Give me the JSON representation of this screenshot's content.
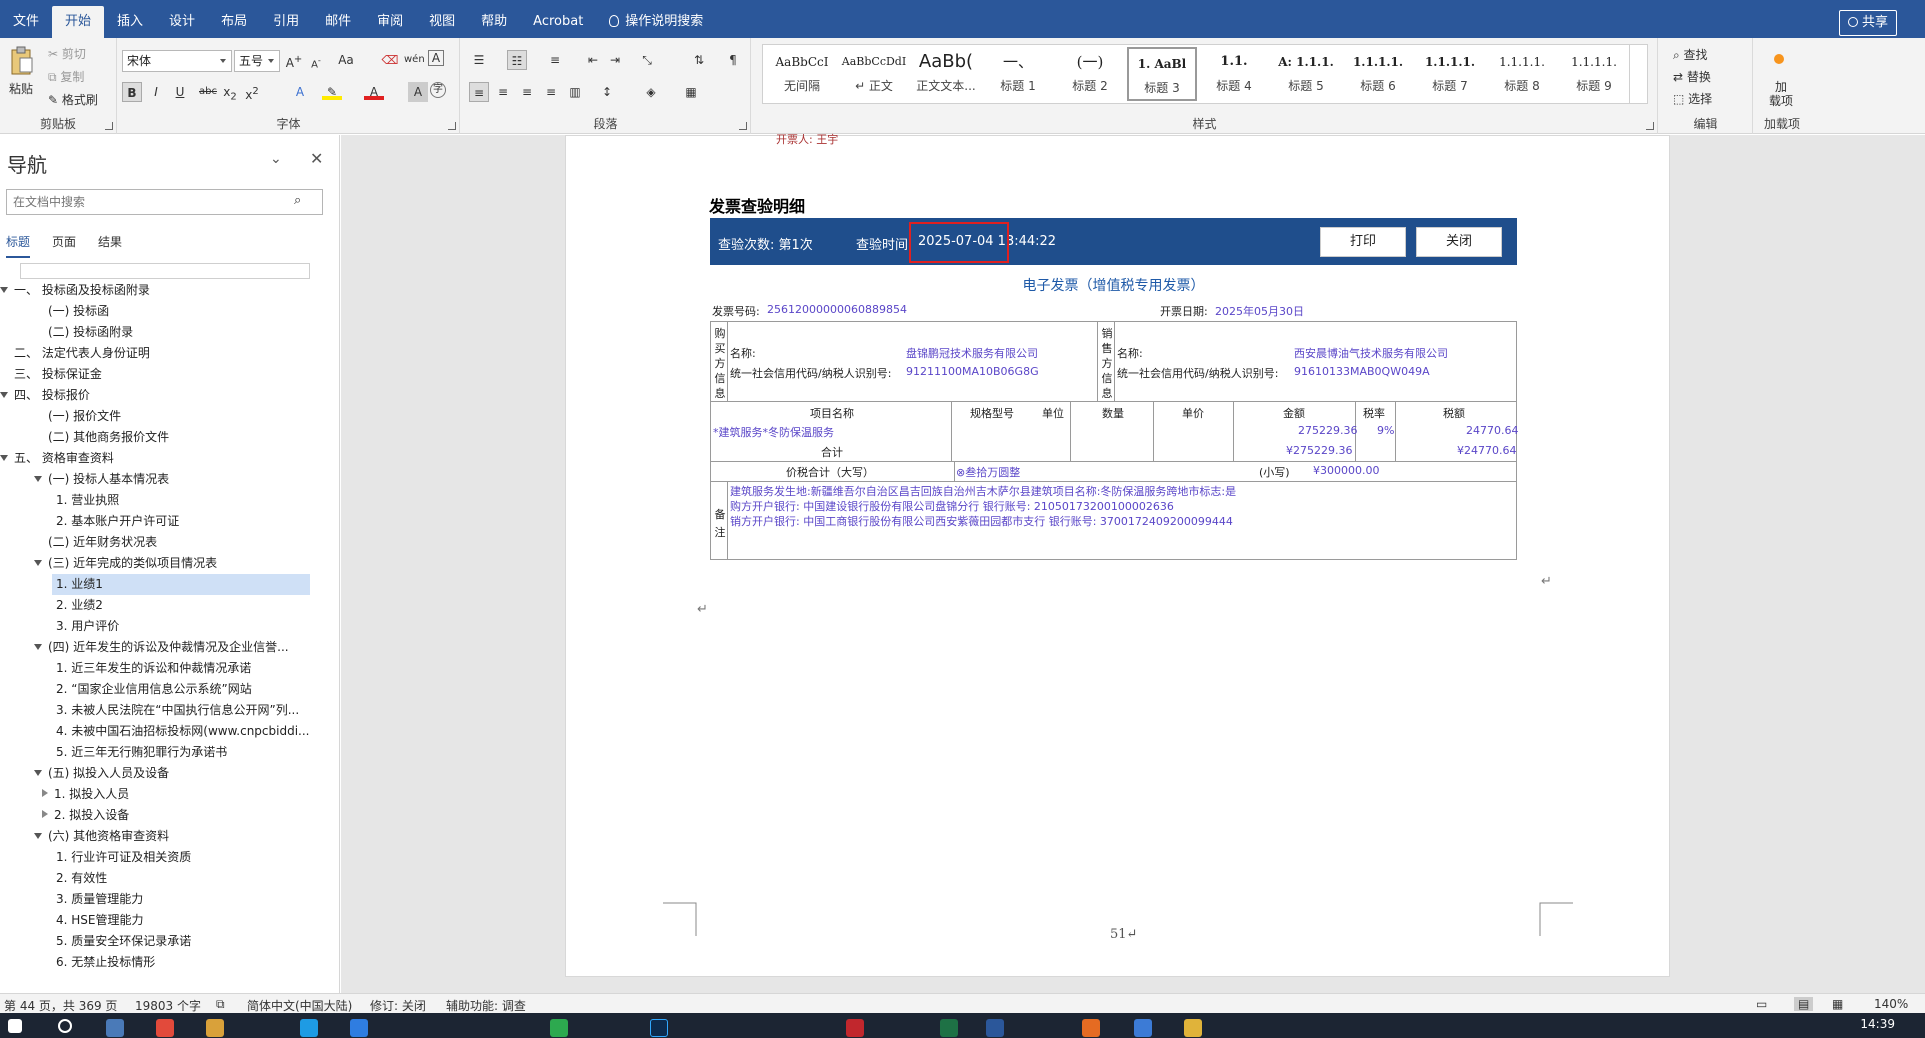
{
  "menu": {
    "items": [
      "文件",
      "开始",
      "插入",
      "设计",
      "布局",
      "引用",
      "邮件",
      "审阅",
      "视图",
      "帮助",
      "Acrobat"
    ],
    "tell_me": "操作说明搜索",
    "share": "共享"
  },
  "ribbon": {
    "clipboard": {
      "paste": "粘贴",
      "cut": "剪切",
      "copy": "复制",
      "format_painter": "格式刷",
      "label": "剪贴板"
    },
    "font": {
      "name": "宋体",
      "size": "五号",
      "label": "字体",
      "case": "Aa"
    },
    "paragraph": {
      "label": "段落"
    },
    "styles": {
      "label": "样式",
      "items": [
        {
          "preview": "AaBbCcI",
          "name": "无间隔"
        },
        {
          "preview": "AaBbCcDdI",
          "name": "↵ 正文"
        },
        {
          "preview": "AaBb(",
          "name": "正文文本..."
        },
        {
          "preview": "一、",
          "name": "标题 1"
        },
        {
          "preview": "(一)",
          "name": "标题 2"
        },
        {
          "preview": "1. AaBl",
          "name": "标题 3"
        },
        {
          "preview": "1.1.",
          "name": "标题 4"
        },
        {
          "preview": "A: 1.1.1.",
          "name": "标题 5"
        },
        {
          "preview": "1.1.1.1.",
          "name": "标题 6"
        },
        {
          "preview": "1.1.1.1.",
          "name": "标题 7"
        },
        {
          "preview": "1.1.1.1.",
          "name": "标题 8"
        },
        {
          "preview": "1.1.1.1.",
          "name": "标题 9"
        }
      ]
    },
    "editing": {
      "find": "查找",
      "replace": "替换",
      "select": "选择",
      "label": "编辑"
    },
    "addins": {
      "btn": "加\n载项",
      "label": "加载项"
    }
  },
  "nav": {
    "title": "导航",
    "search_placeholder": "在文档中搜索",
    "tabs": [
      "标题",
      "页面",
      "结果"
    ],
    "items": [
      {
        "text": "一、 投标函及投标函附录",
        "level": 0,
        "toggle": "open"
      },
      {
        "text": "(一)  投标函",
        "level": 1,
        "toggle": ""
      },
      {
        "text": "(二)  投标函附录",
        "level": 1,
        "toggle": ""
      },
      {
        "text": "二、 法定代表人身份证明",
        "level": 0,
        "toggle": ""
      },
      {
        "text": "三、 投标保证金",
        "level": 0,
        "toggle": ""
      },
      {
        "text": "四、 投标报价",
        "level": 0,
        "toggle": "open"
      },
      {
        "text": "(一)  报价文件",
        "level": 1,
        "toggle": ""
      },
      {
        "text": "(二)  其他商务报价文件",
        "level": 1,
        "toggle": ""
      },
      {
        "text": "五、 资格审查资料",
        "level": 0,
        "toggle": "open"
      },
      {
        "text": "(一)  投标人基本情况表",
        "level": 1,
        "toggle": "open"
      },
      {
        "text": "1. 营业执照",
        "level": 2,
        "toggle": ""
      },
      {
        "text": "2. 基本账户开户许可证",
        "level": 2,
        "toggle": ""
      },
      {
        "text": "(二)  近年财务状况表",
        "level": 1,
        "toggle": ""
      },
      {
        "text": "(三)  近年完成的类似项目情况表",
        "level": 1,
        "toggle": "open"
      },
      {
        "text": "1. 业绩1",
        "level": 2,
        "toggle": "",
        "selected": true
      },
      {
        "text": "2. 业绩2",
        "level": 2,
        "toggle": ""
      },
      {
        "text": "3. 用户评价",
        "level": 2,
        "toggle": ""
      },
      {
        "text": "(四)  近年发生的诉讼及仲裁情况及企业信誉...",
        "level": 1,
        "toggle": "open"
      },
      {
        "text": "1. 近三年发生的诉讼和仲裁情况承诺",
        "level": 2,
        "toggle": ""
      },
      {
        "text": "2. “国家企业信用信息公示系统”网站",
        "level": 2,
        "toggle": ""
      },
      {
        "text": "3. 未被人民法院在“中国执行信息公开网”列...",
        "level": 2,
        "toggle": ""
      },
      {
        "text": "4. 未被中国石油招标投标网(www.cnpcbiddi...",
        "level": 2,
        "toggle": ""
      },
      {
        "text": "5. 近三年无行贿犯罪行为承诺书",
        "level": 2,
        "toggle": ""
      },
      {
        "text": "(五)  拟投入人员及设备",
        "level": 1,
        "toggle": "open"
      },
      {
        "text": "1. 拟投入人员",
        "level": 2,
        "toggle": "closed"
      },
      {
        "text": "2. 拟投入设备",
        "level": 2,
        "toggle": "closed"
      },
      {
        "text": "(六)  其他资格审查资料",
        "level": 1,
        "toggle": "open"
      },
      {
        "text": "1. 行业许可证及相关资质",
        "level": 2,
        "toggle": ""
      },
      {
        "text": "2. 有效性",
        "level": 2,
        "toggle": ""
      },
      {
        "text": "3. 质量管理能力",
        "level": 2,
        "toggle": ""
      },
      {
        "text": "4. HSE管理能力",
        "level": 2,
        "toggle": ""
      },
      {
        "text": "5. 质量安全环保记录承诺",
        "level": 2,
        "toggle": ""
      },
      {
        "text": "6. 无禁止投标情形",
        "level": 2,
        "toggle": ""
      }
    ]
  },
  "doc": {
    "top_cut_text": "开票人:  王宇",
    "invoice_title": "发票查验明细",
    "bar": {
      "count_label": "查验次数:  第1次",
      "time_label": "查验时间",
      "time_value": "2025-07-04 13:44:22",
      "print": "打印",
      "close": "关闭"
    },
    "subtitle": "电子发票（增值税专用发票）",
    "invoice_no_label": "发票号码:",
    "invoice_no": "25612000000060889854",
    "date_label": "开票日期:",
    "date": "2025年05月30日",
    "buyer_side": "购买方信息",
    "seller_side": "销售方信息",
    "name_label": "名称:",
    "tax_label": "统一社会信用代码/纳税人识别号:",
    "buyer_name": "盘锦鹏冠技术服务有限公司",
    "buyer_tax": "91211100MA10B06G8G",
    "seller_name": "西安晨博油气技术服务有限公司",
    "seller_tax": "91610133MAB0QW049A",
    "cols": [
      "项目名称",
      "规格型号",
      "单位",
      "数量",
      "单价",
      "金额",
      "税率",
      "税额"
    ],
    "item_name": "*建筑服务*冬防保温服务",
    "item_amount": "275229.36",
    "item_rate": "9%",
    "item_tax": "24770.64",
    "total_label": "合计",
    "total_amount": "¥275229.36",
    "total_tax": "¥24770.64",
    "grand_label": "价税合计（大写）",
    "grand_upper": "⊗叁拾万圆整",
    "grand_small_label": "(小写)",
    "grand_small": "¥300000.00",
    "remark_side": "备注",
    "remark1": "建筑服务发生地:新疆维吾尔自治区昌吉回族自治州吉木萨尔县建筑项目名称:冬防保温服务跨地市标志:是",
    "remark2": "购方开户银行: 中国建设银行股份有限公司盘锦分行 银行账号: 21050173200100002636",
    "remark3": "销方开户银行: 中国工商银行股份有限公司西安紫薇田园都市支行 银行账号: 3700172409200099444",
    "page_number": "51↵"
  },
  "status": {
    "page": "第 44 页，共 369 页",
    "words": "19803 个字",
    "lang": "简体中文(中国大陆)",
    "track": "修订: 关闭",
    "access": "辅助功能: 调查",
    "zoom": "140%"
  },
  "taskbar": {
    "time": "14:39"
  },
  "colors": {
    "brand": "#2b579a",
    "invoice_bar": "#1f4e8c",
    "highlight": "#e02020",
    "value_text": "#5a46c8"
  }
}
